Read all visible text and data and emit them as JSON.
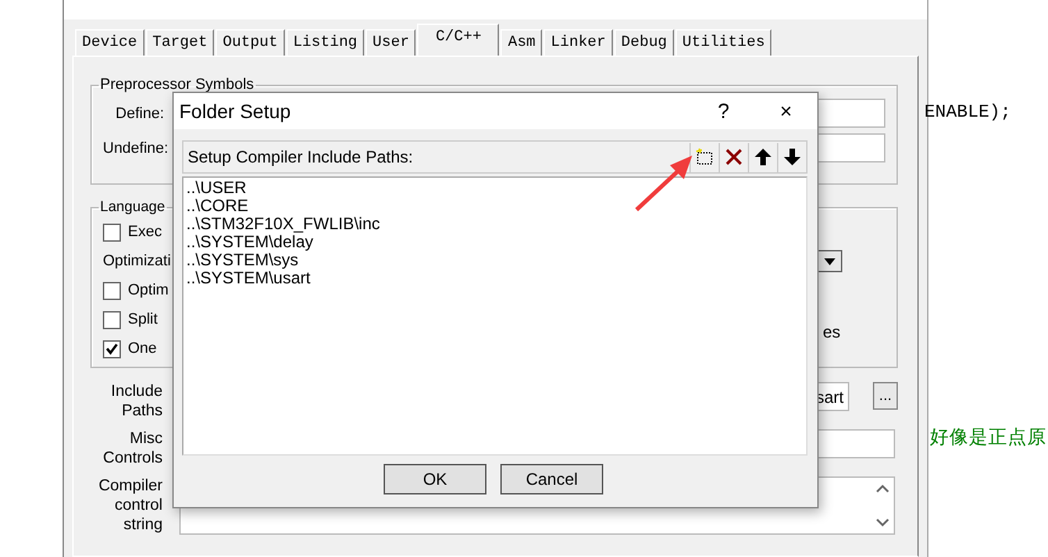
{
  "tabs": [
    {
      "label": "Device",
      "selected": false
    },
    {
      "label": "Target",
      "selected": false
    },
    {
      "label": "Output",
      "selected": false
    },
    {
      "label": "Listing",
      "selected": false
    },
    {
      "label": "User",
      "selected": false
    },
    {
      "label": "C/C++",
      "selected": true
    },
    {
      "label": "Asm",
      "selected": false
    },
    {
      "label": "Linker",
      "selected": false
    },
    {
      "label": "Debug",
      "selected": false
    },
    {
      "label": "Utilities",
      "selected": false
    }
  ],
  "preprocessor": {
    "title": "Preprocessor Symbols",
    "fields": [
      {
        "label": "Define:"
      },
      {
        "label": "Undefine:"
      }
    ]
  },
  "language": {
    "title": "Language",
    "options": [
      {
        "kind": "checkbox",
        "label": "Exec",
        "checked": false
      },
      {
        "kind": "dropdown",
        "label": "Optimizati"
      },
      {
        "kind": "checkbox",
        "label": "Optim",
        "checked": false
      },
      {
        "kind": "checkbox",
        "label": "Split",
        "checked": false
      },
      {
        "kind": "checkbox",
        "label": "One",
        "checked": true
      }
    ],
    "note": "es"
  },
  "include_paths": {
    "label": "Include Paths",
    "value": "sart",
    "browse": "..."
  },
  "misc_controls": {
    "label": "Misc Controls"
  },
  "compiler_string": {
    "label": "Compiler control string"
  },
  "folder_setup": {
    "title": "Folder Setup",
    "help": "?",
    "close": "×",
    "heading": "Setup Compiler Include Paths:",
    "paths": [
      "..\\USER",
      "..\\CORE",
      "..\\STM32F10X_FWLIB\\inc",
      "..\\SYSTEM\\delay",
      "..\\SYSTEM\\sys",
      "..\\SYSTEM\\usart"
    ],
    "buttons": [
      "OK",
      "Cancel"
    ]
  },
  "editor": {
    "lines": [
      {
        "kind": "code",
        "text": "ENABLE);"
      },
      {
        "kind": "comment",
        "text": "好像是正点原"
      }
    ]
  }
}
